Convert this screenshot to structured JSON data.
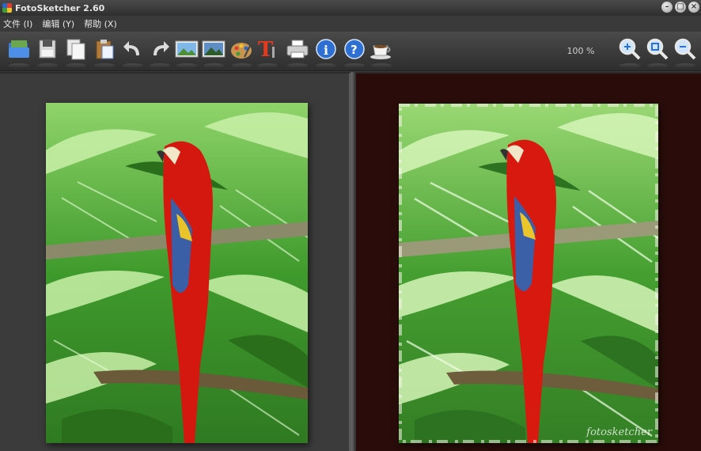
{
  "window": {
    "title": "FotoSketcher 2.60"
  },
  "menu": {
    "items": [
      "文件 (I)",
      "编辑 (Y)",
      "帮助 (X)"
    ]
  },
  "toolbar": {
    "buttons": [
      "open-folder-icon",
      "save-icon",
      "copy-icon",
      "paste-icon",
      "undo-icon",
      "redo-icon",
      "landscape-icon",
      "landscape-alt-icon",
      "palette-icon",
      "text-icon",
      "print-icon",
      "info-icon",
      "help-icon",
      "coffee-icon",
      "zoom-in-icon",
      "zoom-fit-icon",
      "zoom-out-icon"
    ],
    "zoom_label": "100 %"
  },
  "colors": {
    "right_background": "#2a0d0a",
    "parrot_red": "#d4180f",
    "leaf_green": "#3c9c2a"
  },
  "right_pane": {
    "signature": "fotosketcher"
  }
}
